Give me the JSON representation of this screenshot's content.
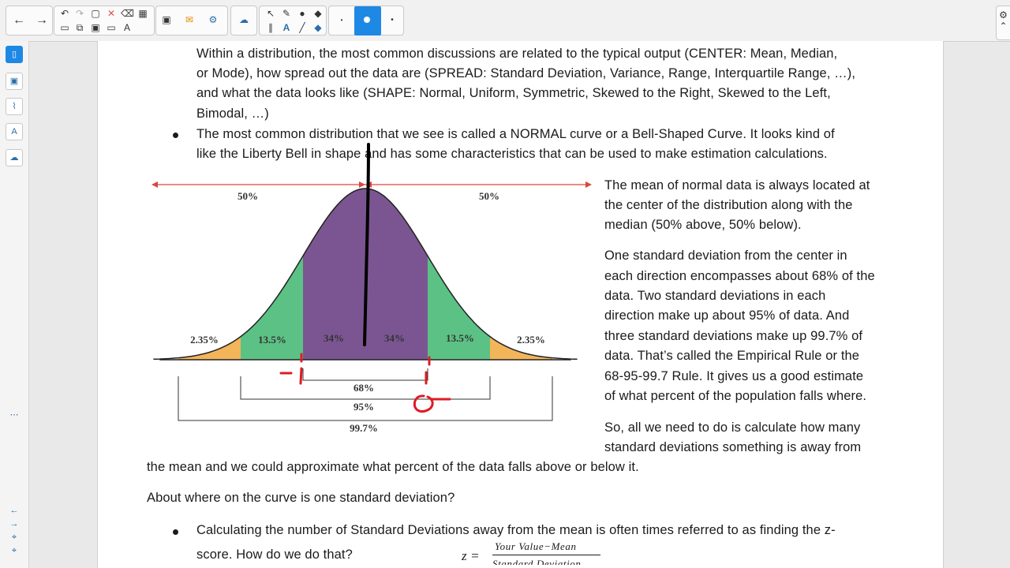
{
  "toolbar": {
    "undo_icon": "undo-icon",
    "redo_icon": "redo-icon"
  },
  "document": {
    "para1": [
      "Within a distribution, the most common discussions are related to the typical output (CENTER: Mean, Median,",
      "or Mode), how spread out the data are (SPREAD: Standard Deviation, Variance, Range, Interquartile Range, …),",
      "and what the data looks like (SHAPE: Normal, Uniform, Symmetric, Skewed to the Right, Skewed to the Left,",
      "Bimodal, …)"
    ],
    "bullet2": [
      "The most common distribution that we see is called a NORMAL curve or a Bell-Shaped Curve.  It looks kind of",
      "like the Liberty Bell in shape and has some characteristics that can be used to make estimation calculations."
    ],
    "right_text": [
      "The mean of normal data is always located at",
      "the center of the distribution along with the",
      "median (50% above, 50% below).",
      "One standard deviation from the center in",
      "each direction encompasses about 68% of the",
      "data.  Two standard deviations in each",
      "direction make up about 95% of data.  And",
      "three standard deviations make up 99.7% of",
      "data.  That’s called the Empirical Rule or the",
      "68-95-99.7 Rule.  It gives us a good estimate",
      "of what percent of the population falls where.",
      "So, all we need to do is calculate how many",
      "standard deviations something is away from"
    ],
    "full_line": "the mean and we could approximate what percent of the data falls above or below it.",
    "question": "About where on the curve is one standard deviation?",
    "bullet3": [
      "Calculating the number of Standard Deviations away from the mean is often times referred to as finding the z-",
      "score.  How do we do that?"
    ],
    "formula": {
      "lhs": "z =",
      "numerator": "Your Value−Mean",
      "denominator": "Standard Deviation"
    }
  },
  "chart_data": {
    "type": "area",
    "title": "",
    "regions": [
      {
        "label": "2.35%",
        "from": -3,
        "to": -2,
        "color": "#f2b55a"
      },
      {
        "label": "13.5%",
        "from": -2,
        "to": -1,
        "color": "#5cc184"
      },
      {
        "label": "34%",
        "from": -1,
        "to": 0,
        "color": "#7b5591"
      },
      {
        "label": "34%",
        "from": 0,
        "to": 1,
        "color": "#7b5591"
      },
      {
        "label": "13.5%",
        "from": 1,
        "to": 2,
        "color": "#5cc184"
      },
      {
        "label": "2.35%",
        "from": 2,
        "to": 3,
        "color": "#f2b55a"
      }
    ],
    "halves": [
      "50%",
      "50%"
    ],
    "brackets": [
      "68%",
      "95%",
      "99.7%"
    ],
    "xlim": [
      -3.4,
      3.4
    ],
    "arrow_color": "#d9473e"
  },
  "annotations": {
    "ink_black": "#000000",
    "ink_red": "#e01b24"
  }
}
